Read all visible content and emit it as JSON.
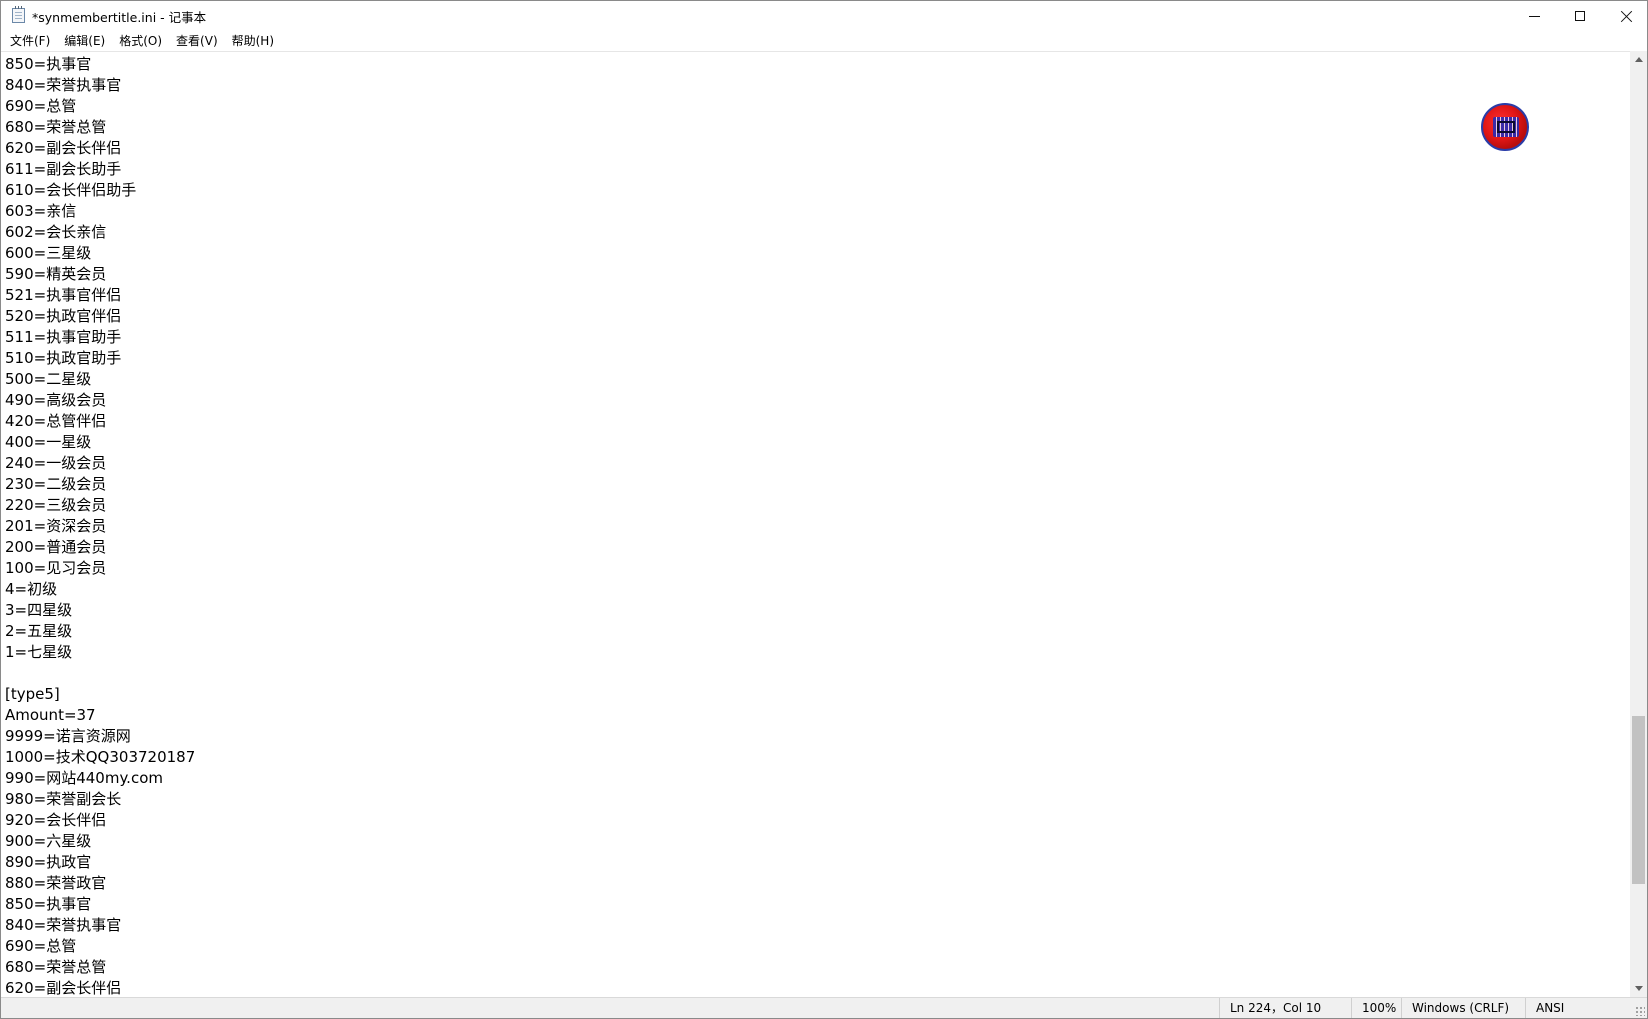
{
  "window": {
    "title": "*synmembertitle.ini - 记事本"
  },
  "menu": [
    {
      "label": "文件(F)"
    },
    {
      "label": "编辑(E)"
    },
    {
      "label": "格式(O)"
    },
    {
      "label": "查看(V)"
    },
    {
      "label": "帮助(H)"
    }
  ],
  "editor": {
    "lines": [
      "850=执事官",
      "840=荣誉执事官",
      "690=总管",
      "680=荣誉总管",
      "620=副会长伴侣",
      "611=副会长助手",
      "610=会长伴侣助手",
      "603=亲信",
      "602=会长亲信",
      "600=三星级",
      "590=精英会员",
      "521=执事官伴侣",
      "520=执政官伴侣",
      "511=执事官助手",
      "510=执政官助手",
      "500=二星级",
      "490=高级会员",
      "420=总管伴侣",
      "400=一星级",
      "240=一级会员",
      "230=二级会员",
      "220=三级会员",
      "201=资深会员",
      "200=普通会员",
      "100=见习会员",
      "4=初级",
      "3=四星级",
      "2=五星级",
      "1=七星级",
      "",
      "[type5]",
      "Amount=37",
      "9999=诺言资源网",
      "1000=技术QQ303720187",
      "990=网站440my.com",
      "980=荣誉副会长",
      "920=会长伴侣",
      "900=六星级",
      "890=执政官",
      "880=荣誉政官",
      "850=执事官",
      "840=荣誉执事官",
      "690=总管",
      "680=荣誉总管",
      "620=副会长伴侣"
    ]
  },
  "status": {
    "position": "Ln 224，Col 10",
    "zoom": "100%",
    "line_ending": "Windows (CRLF)",
    "encoding": "ANSI"
  },
  "icons": {
    "app": "notepad-icon",
    "overlay": "floating-badge-icon"
  }
}
